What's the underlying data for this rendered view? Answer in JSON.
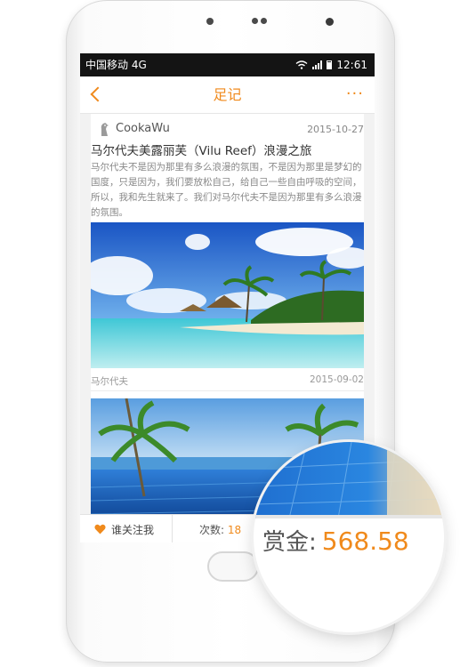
{
  "status": {
    "carrier": "中国移动 4G",
    "time": "12:61"
  },
  "nav": {
    "title": "足记",
    "more": "···"
  },
  "post": {
    "author": "CookaWu",
    "date": "2015-10-27",
    "title": "马尔代夫美露丽芙（Vilu Reef）浪漫之旅",
    "body": "马尔代夫不是因为那里有多么浪漫的氛围，不是因为那里是梦幻的国度，只是因为，我们要放松自己，给自己一些自由呼吸的空间，所以，我和先生就来了。我们对马尔代夫不是因为那里有多么浪漫的氛围。",
    "photo_caption": "马尔代夫",
    "photo_date": "2015-09-02"
  },
  "bottom": {
    "follow_label": "谁关注我",
    "count_label": "次数:",
    "count_value": "18"
  },
  "magnifier": {
    "reward_label": "赏金:",
    "reward_value": "568.58"
  },
  "colors": {
    "accent": "#f08a1c",
    "statusbar": "#141414"
  }
}
